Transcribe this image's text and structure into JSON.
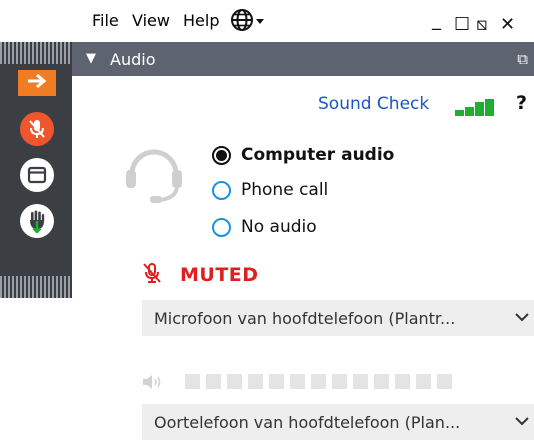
{
  "menu": {
    "file": "File",
    "view": "View",
    "help": "Help",
    "globe_icon": "globe-icon",
    "window_controls": {
      "minimize": "_",
      "restore": "☐",
      "expand": "⧅",
      "close": "✕"
    }
  },
  "panel": {
    "title": "Audio",
    "collapse_icon": "triangle-down-icon",
    "undock_icon": "undock-icon"
  },
  "audio": {
    "sound_check": "Sound Check",
    "help": "?",
    "options": [
      {
        "label": "Computer audio",
        "selected": true
      },
      {
        "label": "Phone call",
        "selected": false
      },
      {
        "label": "No audio",
        "selected": false
      }
    ],
    "muted_label": "MUTED",
    "microphone": "Microfoon van hoofdtelefoon (Plantr...",
    "speaker": "Oortelefoon van hoofdtelefoon (Plan...",
    "speaker_level_segments": 13
  },
  "colors": {
    "accent_orange": "#f07d23",
    "muted_red": "#e02020",
    "link_blue": "#1a56c4",
    "signal_green": "#1fae31",
    "sidebar": "#3b3f44",
    "header": "#5d646f"
  }
}
